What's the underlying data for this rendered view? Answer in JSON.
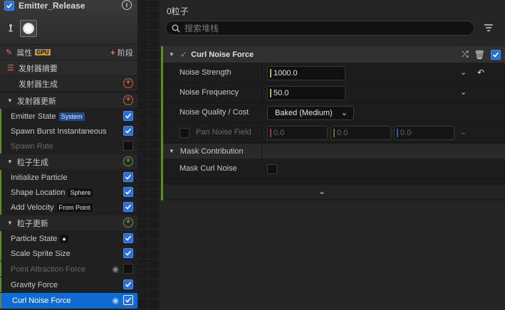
{
  "emitter": {
    "name": "Emitter_Release"
  },
  "stack": {
    "properties_label": "属性",
    "gpu_badge": "GPU",
    "stage_label": "阶段",
    "summary_label": "发射器摘要",
    "emitter_spawn_label": "发射器生成",
    "emitter_update_label": "发射器更新",
    "emitter_update_items": [
      {
        "label": "Emitter State",
        "badge": "System",
        "checked": true
      },
      {
        "label": "Spawn Burst Instantaneous",
        "checked": true
      },
      {
        "label": "Spawn Rate",
        "checked": false
      }
    ],
    "particle_spawn_label": "粒子生成",
    "particle_spawn_items": [
      {
        "label": "Initialize Particle",
        "checked": true
      },
      {
        "label": "Shape Location",
        "badge": "Sphere",
        "checked": true
      },
      {
        "label": "Add Velocity",
        "badge": "From Point",
        "checked": true
      }
    ],
    "particle_update_label": "粒子更新",
    "particle_update_items": [
      {
        "label": "Particle State",
        "checked": true
      },
      {
        "label": "Scale Sprite Size",
        "checked": true
      },
      {
        "label": "Point Attraction Force",
        "checked": false
      },
      {
        "label": "Gravity Force",
        "checked": true
      },
      {
        "label": "Curl Noise Force",
        "checked": true,
        "selected": true
      }
    ]
  },
  "details": {
    "title": "0粒子",
    "search_placeholder": "搜索堆栈",
    "module_name": "Curl Noise Force",
    "params": {
      "noise_strength_label": "Noise Strength",
      "noise_strength_value": "1000.0",
      "noise_frequency_label": "Noise Frequency",
      "noise_frequency_value": "50.0",
      "noise_quality_label": "Noise Quality / Cost",
      "noise_quality_value": "Baked (Medium)",
      "pan_noise_label": "Pan Noise Field",
      "pan_x": "0.0",
      "pan_y": "0.0",
      "pan_z": "0.0",
      "mask_section_label": "Mask Contribution",
      "mask_curl_label": "Mask Curl Noise"
    }
  },
  "colors": {
    "accent_blue": "#0f6ad4",
    "module_green": "#5c8a3a",
    "add_orange": "#d06a3a"
  }
}
